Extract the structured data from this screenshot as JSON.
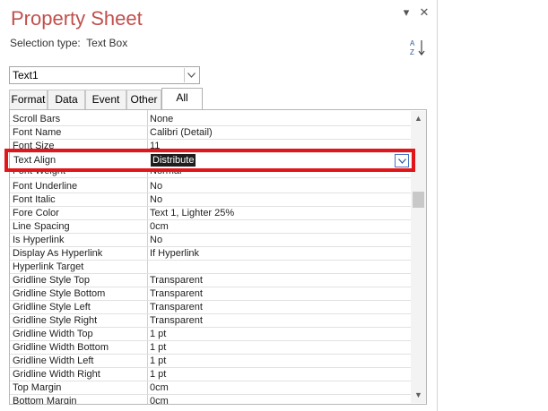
{
  "pane": {
    "title": "Property Sheet",
    "selection_label": "Selection type:",
    "selection_value": "Text Box",
    "window_buttons": [
      "▾",
      "✕"
    ],
    "sort_icon": "sort-az-icon"
  },
  "object_combo": {
    "value": "Text1"
  },
  "tabs": [
    {
      "label": "Format"
    },
    {
      "label": "Data"
    },
    {
      "label": "Event"
    },
    {
      "label": "Other"
    },
    {
      "label": "All"
    }
  ],
  "selected_tab": "All",
  "properties": [
    {
      "name": "Scroll Bars",
      "value": "None"
    },
    {
      "name": "Font Name",
      "value": "Calibri (Detail)"
    },
    {
      "name": "Font Size",
      "value": "11"
    },
    {
      "name": "Text Align",
      "value": "Distribute"
    },
    {
      "name": "Font Weight",
      "value": "Normal"
    },
    {
      "name": "Font Underline",
      "value": "No"
    },
    {
      "name": "Font Italic",
      "value": "No"
    },
    {
      "name": "Fore Color",
      "value": "Text 1, Lighter 25%"
    },
    {
      "name": "Line Spacing",
      "value": "0cm"
    },
    {
      "name": "Is Hyperlink",
      "value": "No"
    },
    {
      "name": "Display As Hyperlink",
      "value": "If Hyperlink"
    },
    {
      "name": "Hyperlink Target",
      "value": ""
    },
    {
      "name": "Gridline Style Top",
      "value": "Transparent"
    },
    {
      "name": "Gridline Style Bottom",
      "value": "Transparent"
    },
    {
      "name": "Gridline Style Left",
      "value": "Transparent"
    },
    {
      "name": "Gridline Style Right",
      "value": "Transparent"
    },
    {
      "name": "Gridline Width Top",
      "value": "1 pt"
    },
    {
      "name": "Gridline Width Bottom",
      "value": "1 pt"
    },
    {
      "name": "Gridline Width Left",
      "value": "1 pt"
    },
    {
      "name": "Gridline Width Right",
      "value": "1 pt"
    },
    {
      "name": "Top Margin",
      "value": "0cm"
    },
    {
      "name": "Bottom Margin",
      "value": "0cm"
    }
  ],
  "selected_property": {
    "name": "Text Align",
    "value": "Distribute"
  },
  "colors": {
    "title": "#c0504d",
    "highlight": "#e0161b",
    "accent": "#4472c4"
  }
}
